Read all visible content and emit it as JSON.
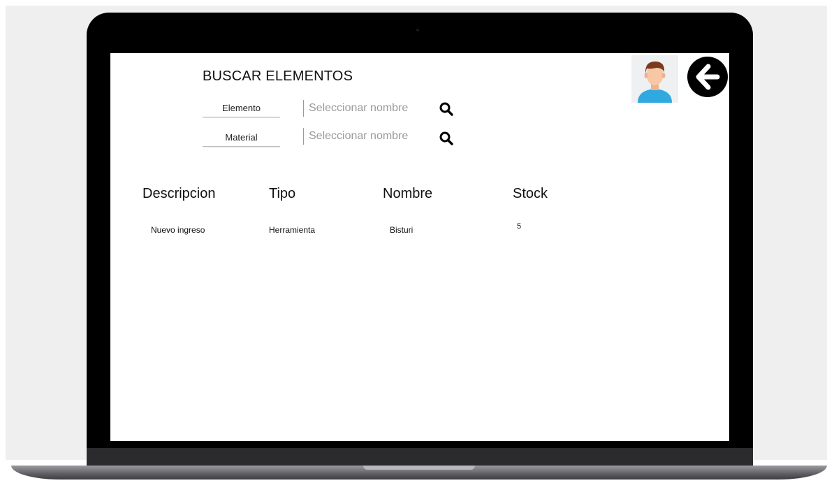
{
  "page": {
    "title": "BUSCAR ELEMENTOS"
  },
  "filters": [
    {
      "button_label": "Elemento",
      "input_placeholder": "Seleccionar nombre",
      "input_value": "",
      "icon": "search-icon"
    },
    {
      "button_label": "Material",
      "input_placeholder": "Seleccionar nombre",
      "input_value": "",
      "icon": "search-icon"
    }
  ],
  "header_actions": {
    "avatar_icon": "user-avatar-icon",
    "back_icon": "arrow-left-icon"
  },
  "table": {
    "columns": [
      "Descripcion",
      "Tipo",
      "Nombre",
      "Stock"
    ],
    "rows": [
      [
        "Nuevo ingreso",
        "Herramienta",
        "Bisturi",
        "5"
      ]
    ]
  },
  "colors": {
    "laptop_frame": "#000000",
    "screen_background": "#ffffff",
    "back_button": "#000000",
    "avatar_shirt": "#2fa9e0",
    "avatar_hair": "#7a3a1d"
  }
}
